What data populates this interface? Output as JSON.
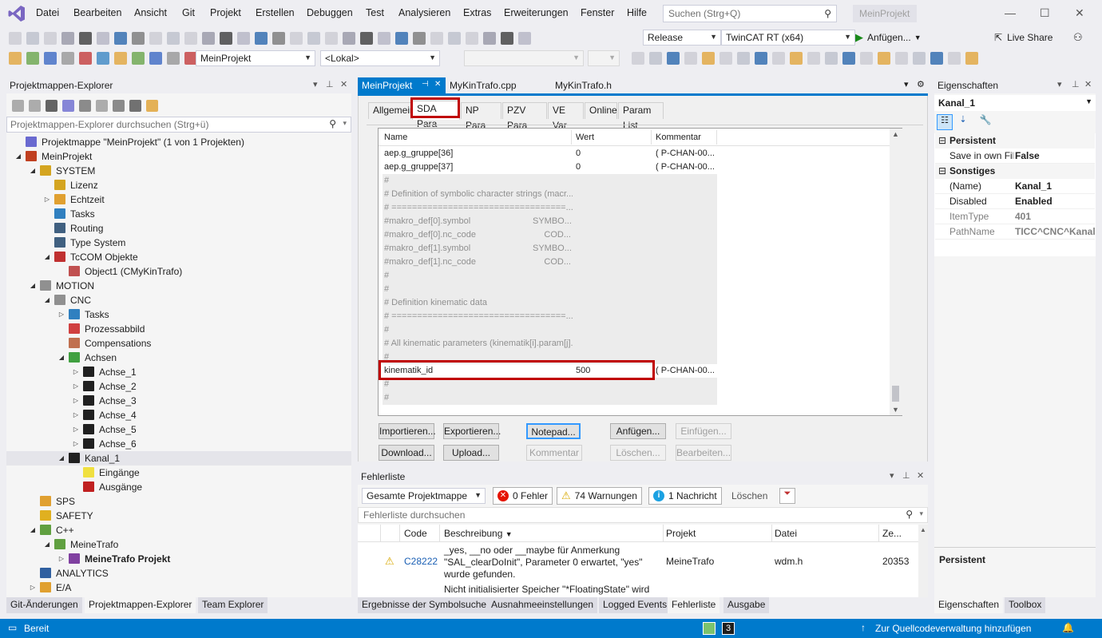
{
  "menu": [
    "Datei",
    "Bearbeiten",
    "Ansicht",
    "Git",
    "Projekt",
    "Erstellen",
    "Debuggen",
    "Test",
    "Analysieren",
    "Extras",
    "Erweiterungen",
    "Fenster",
    "Hilfe"
  ],
  "search": {
    "placeholder": "Suchen (Strg+Q)"
  },
  "project_badge": "MeinProjekt",
  "toolbar": {
    "config": "Release",
    "platform": "TwinCAT RT (x64)",
    "run_label": "Anfügen...",
    "live_share": "Live Share",
    "project_combo": "MeinProjekt",
    "target_combo": "<Lokal>"
  },
  "solution_explorer": {
    "title": "Projektmappen-Explorer",
    "search_placeholder": "Projektmappen-Explorer durchsuchen (Strg+ü)",
    "items": [
      {
        "label": "Projektmappe \"MeinProjekt\" (1 von 1 Projekten)",
        "level": 0,
        "exp": "",
        "icon": "#6a6ad0"
      },
      {
        "label": "MeinProjekt",
        "level": 0,
        "exp": "open",
        "icon": "#c04020"
      },
      {
        "label": "SYSTEM",
        "level": 1,
        "exp": "open",
        "icon": "#d4a520"
      },
      {
        "label": "Lizenz",
        "level": 2,
        "exp": "",
        "icon": "#d4a520"
      },
      {
        "label": "Echtzeit",
        "level": 2,
        "exp": "closed",
        "icon": "#e0a030"
      },
      {
        "label": "Tasks",
        "level": 2,
        "exp": "",
        "icon": "#3080c0"
      },
      {
        "label": "Routing",
        "level": 2,
        "exp": "",
        "icon": "#406080"
      },
      {
        "label": "Type System",
        "level": 2,
        "exp": "",
        "icon": "#406080"
      },
      {
        "label": "TcCOM Objekte",
        "level": 2,
        "exp": "open",
        "icon": "#c03030"
      },
      {
        "label": "Object1 (CMyKinTrafo)",
        "level": 3,
        "exp": "",
        "icon": "#c05050"
      },
      {
        "label": "MOTION",
        "level": 1,
        "exp": "open",
        "icon": "#909090"
      },
      {
        "label": "CNC",
        "level": 2,
        "exp": "open",
        "icon": "#909090"
      },
      {
        "label": "Tasks",
        "level": 3,
        "exp": "closed",
        "icon": "#3080c0"
      },
      {
        "label": "Prozessabbild",
        "level": 3,
        "exp": "",
        "icon": "#d04040"
      },
      {
        "label": "Compensations",
        "level": 3,
        "exp": "",
        "icon": "#c07050"
      },
      {
        "label": "Achsen",
        "level": 3,
        "exp": "open",
        "icon": "#40a040"
      },
      {
        "label": "Achse_1",
        "level": 4,
        "exp": "closed",
        "icon": "#202020"
      },
      {
        "label": "Achse_2",
        "level": 4,
        "exp": "closed",
        "icon": "#202020"
      },
      {
        "label": "Achse_3",
        "level": 4,
        "exp": "closed",
        "icon": "#202020"
      },
      {
        "label": "Achse_4",
        "level": 4,
        "exp": "closed",
        "icon": "#202020"
      },
      {
        "label": "Achse_5",
        "level": 4,
        "exp": "closed",
        "icon": "#202020"
      },
      {
        "label": "Achse_6",
        "level": 4,
        "exp": "closed",
        "icon": "#202020"
      },
      {
        "label": "Kanal_1",
        "level": 3,
        "exp": "open",
        "icon": "#202020",
        "selected": true
      },
      {
        "label": "Eingänge",
        "level": 4,
        "exp": "",
        "icon": "#f0e040"
      },
      {
        "label": "Ausgänge",
        "level": 4,
        "exp": "",
        "icon": "#c02020"
      },
      {
        "label": "SPS",
        "level": 1,
        "exp": "",
        "icon": "#e0a030"
      },
      {
        "label": "SAFETY",
        "level": 1,
        "exp": "",
        "icon": "#e0b020"
      },
      {
        "label": "C++",
        "level": 1,
        "exp": "open",
        "icon": "#60a040"
      },
      {
        "label": "MeineTrafo",
        "level": 2,
        "exp": "open",
        "icon": "#60a040"
      },
      {
        "label": "MeineTrafo Projekt",
        "level": 3,
        "exp": "closed",
        "icon": "#8040a0",
        "bold": true
      },
      {
        "label": "ANALYTICS",
        "level": 1,
        "exp": "",
        "icon": "#3060a0"
      },
      {
        "label": "E/A",
        "level": 1,
        "exp": "closed",
        "icon": "#e0a030"
      }
    ],
    "bottom_tabs": [
      "Git-Änderungen",
      "Projektmappen-Explorer",
      "Team Explorer"
    ]
  },
  "editor": {
    "doc_tabs": [
      "MeinProjekt",
      "MyKinTrafo.cpp",
      "MyKinTrafo.h"
    ],
    "inner_tabs": [
      "Allgemein",
      "SDA Para",
      "NP Para",
      "PZV Para",
      "VE Var",
      "Online",
      "Param List"
    ],
    "grid_headers": [
      "Name",
      "Wert",
      "Kommentar"
    ],
    "rows": [
      {
        "name": "aep.g_gruppe[36]",
        "value": "0",
        "comment": "( P-CHAN-00...",
        "grey": false
      },
      {
        "name": "aep.g_gruppe[37]",
        "value": "0",
        "comment": "( P-CHAN-00...",
        "grey": false
      },
      {
        "name": "#",
        "value": "",
        "comment": "",
        "grey": true
      },
      {
        "name": "# Definition of symbolic character strings (macr...",
        "value": "",
        "comment": "",
        "grey": true
      },
      {
        "name": "# ==================================...",
        "value": "",
        "comment": "",
        "grey": true
      },
      {
        "name": "#makro_def[0].symbol",
        "value": "SYMBO...",
        "comment": "",
        "grey": true
      },
      {
        "name": "#makro_def[0].nc_code",
        "value": "COD...",
        "comment": "",
        "grey": true
      },
      {
        "name": "#makro_def[1].symbol",
        "value": "SYMBO...",
        "comment": "",
        "grey": true
      },
      {
        "name": "#makro_def[1].nc_code",
        "value": "COD...",
        "comment": "",
        "grey": true
      },
      {
        "name": "#",
        "value": "",
        "comment": "",
        "grey": true
      },
      {
        "name": "#",
        "value": "",
        "comment": "",
        "grey": true
      },
      {
        "name": "# Definition kinematic data",
        "value": "",
        "comment": "",
        "grey": true
      },
      {
        "name": "# ==================================...",
        "value": "",
        "comment": "",
        "grey": true
      },
      {
        "name": "#",
        "value": "",
        "comment": "",
        "grey": true
      },
      {
        "name": "# All kinematic parameters (kinematik[i].param[j]...",
        "value": "",
        "comment": "",
        "grey": true
      },
      {
        "name": "#",
        "value": "",
        "comment": "",
        "grey": true
      },
      {
        "name": "kinematik_id",
        "value": "500",
        "comment": "( P-CHAN-00...",
        "grey": false
      },
      {
        "name": "#",
        "value": "",
        "comment": "",
        "grey": true
      },
      {
        "name": "#",
        "value": "",
        "comment": "",
        "grey": true
      }
    ],
    "buttons_row1": [
      "Importieren...",
      "Exportieren...",
      "Notepad...",
      "Anfügen...",
      "Einfügen..."
    ],
    "buttons_row2": [
      "Download...",
      "Upload...",
      "Kommentar",
      "Löschen...",
      "Bearbeiten..."
    ]
  },
  "error_list": {
    "title": "Fehlerliste",
    "scope": "Gesamte Projektmappe",
    "errors": "0 Fehler",
    "warnings": "74 Warnungen",
    "messages": "1 Nachricht",
    "clear": "Löschen",
    "search_placeholder": "Fehlerliste durchsuchen",
    "headers": [
      "Code",
      "Beschreibung",
      "Projekt",
      "Datei",
      "Ze..."
    ],
    "row1": {
      "code": "C28222",
      "desc": "_yes, __no oder __maybe für Anmerkung \"SAL_clearDoInit\", Parameter 0 erwartet, \"yes\" wurde gefunden.",
      "project": "MeineTrafo",
      "file": "wdm.h",
      "line": "20353"
    },
    "row2_desc": "Nicht initialisierter Speicher \"*FloatingState\" wird",
    "bottom_tabs": [
      "Ergebnisse der Symbolsuche",
      "Ausnahmeeinstellungen",
      "Logged Events",
      "Fehlerliste",
      "Ausgabe"
    ]
  },
  "properties": {
    "title": "Eigenschaften",
    "object": "Kanal_1",
    "cat1": "Persistent",
    "rows1": [
      {
        "name": "Save in own Fil",
        "value": "False"
      }
    ],
    "cat2": "Sonstiges",
    "rows2": [
      {
        "name": "(Name)",
        "value": "Kanal_1",
        "grey": false
      },
      {
        "name": "Disabled",
        "value": "Enabled",
        "grey": false
      },
      {
        "name": "ItemType",
        "value": "401",
        "grey": true
      },
      {
        "name": "PathName",
        "value": "TICC^CNC^Kanal_",
        "grey": true
      }
    ],
    "desc_title": "Persistent",
    "bottom_tabs": [
      "Eigenschaften",
      "Toolbox"
    ]
  },
  "status": {
    "ready": "Bereit",
    "count": "3",
    "scm": "Zur Quellcodeverwaltung hinzufügen"
  },
  "colors": {
    "accent": "#007acc",
    "status_bar": "#007acc",
    "highlight_red": "#c00000",
    "title_bar": "#eeeef2"
  }
}
